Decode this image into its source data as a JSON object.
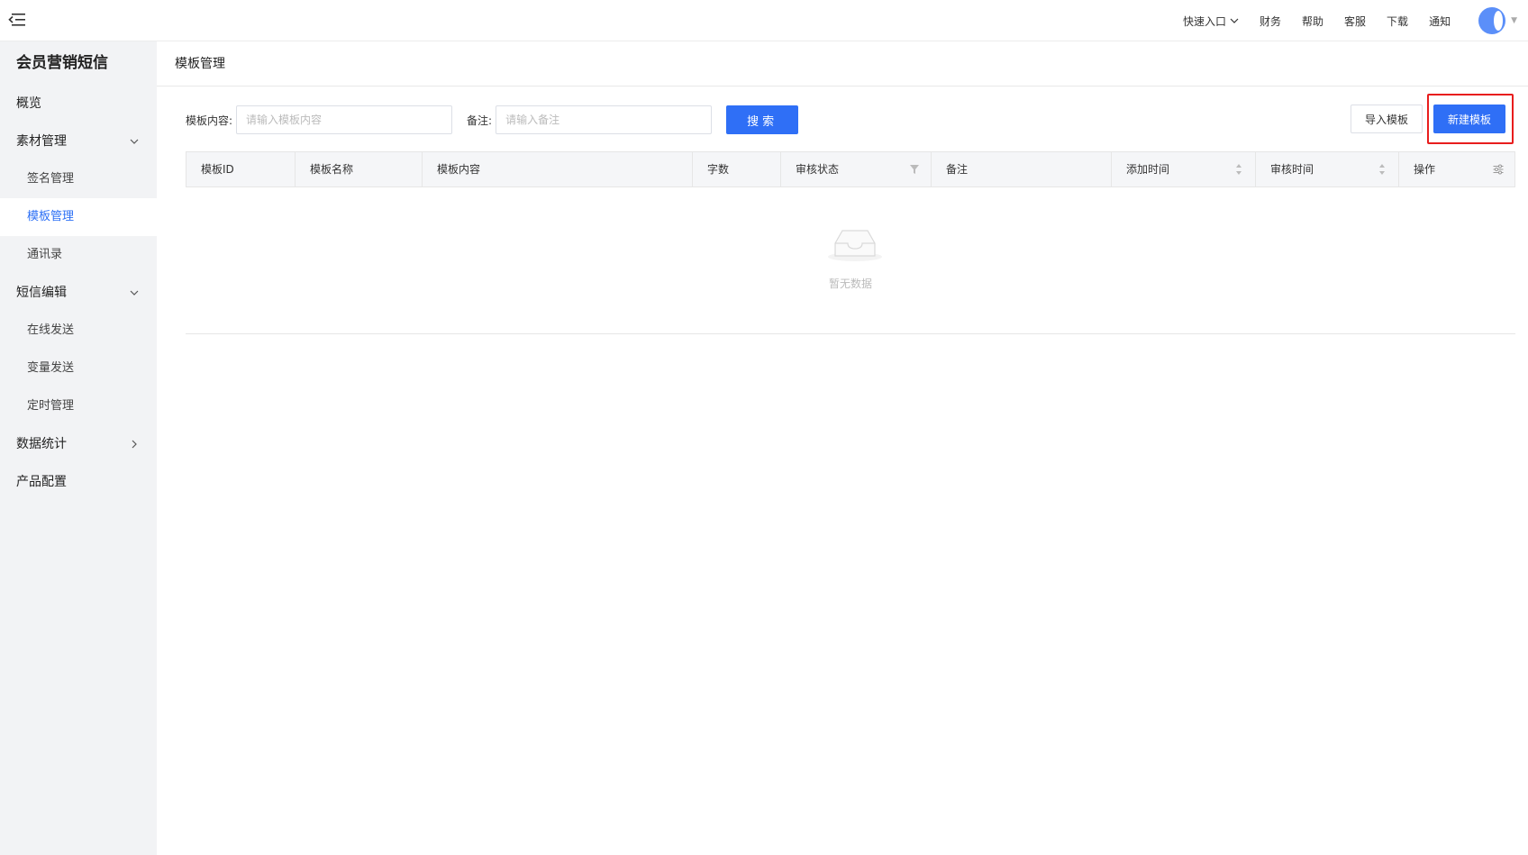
{
  "topbar": {
    "menu_icon": "menu-fold-icon",
    "links": [
      "快速入口",
      "财务",
      "帮助",
      "客服",
      "下载",
      "通知"
    ],
    "quick_entry_icon": "chevron-down-icon",
    "avatar_color": "#5b8ff9"
  },
  "sidebar": {
    "title": "会员营销短信",
    "overview": "概览",
    "material": {
      "label": "素材管理",
      "items": [
        "签名管理",
        "模板管理",
        "通讯录"
      ]
    },
    "sms_edit": {
      "label": "短信编辑",
      "items": [
        "在线发送",
        "变量发送",
        "定时管理"
      ]
    },
    "stats": "数据统计",
    "product": "产品配置",
    "active_item": "模板管理",
    "active_color": "#2b6ff5"
  },
  "page": {
    "title": "模板管理"
  },
  "filters": {
    "content_label": "模板内容:",
    "content_placeholder": "请输入模板内容",
    "remark_label": "备注:",
    "remark_placeholder": "请输入备注",
    "search_button": "搜索",
    "import_button": "导入模板",
    "new_button": "新建模板",
    "primary_color": "#2f6ff6",
    "highlight_color": "#e81d1d"
  },
  "table": {
    "columns": [
      "模板ID",
      "模板名称",
      "模板内容",
      "字数",
      "审核状态",
      "备注",
      "添加时间",
      "审核时间",
      "操作"
    ],
    "rows": [],
    "empty_text": "暂无数据",
    "empty_icon": "empty-inbox-icon"
  }
}
